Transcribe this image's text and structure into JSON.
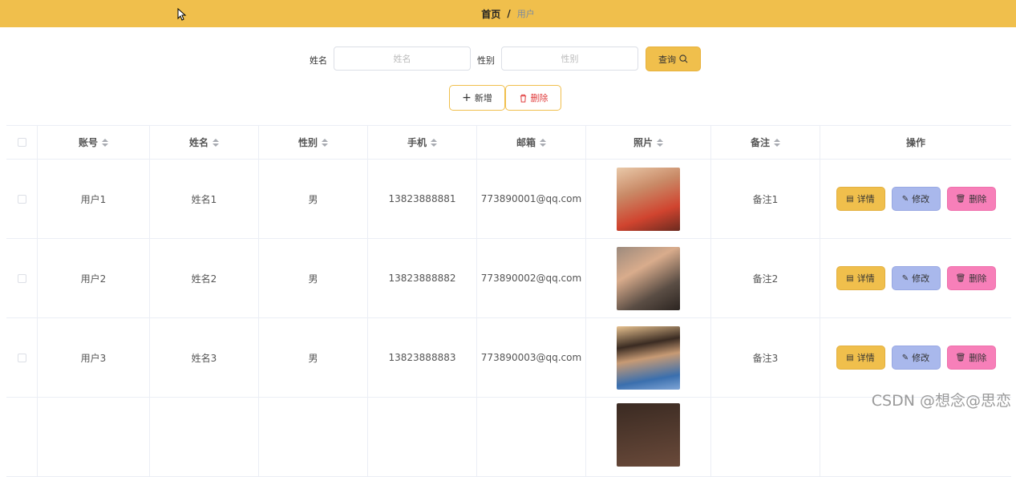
{
  "breadcrumb": {
    "home": "首页",
    "separator": "/",
    "current": "用户"
  },
  "search": {
    "name_label": "姓名",
    "name_placeholder": "姓名",
    "gender_label": "性别",
    "gender_placeholder": "性别",
    "query_label": "查询"
  },
  "actions": {
    "add_label": "新增",
    "delete_label": "删除"
  },
  "table": {
    "headers": [
      "账号",
      "姓名",
      "性别",
      "手机",
      "邮箱",
      "照片",
      "备注",
      "操作"
    ],
    "rows": [
      {
        "account": "用户1",
        "name": "姓名1",
        "gender": "男",
        "phone": "13823888881",
        "email": "773890001@qq.com",
        "remark": "备注1"
      },
      {
        "account": "用户2",
        "name": "姓名2",
        "gender": "男",
        "phone": "13823888882",
        "email": "773890002@qq.com",
        "remark": "备注2"
      },
      {
        "account": "用户3",
        "name": "姓名3",
        "gender": "男",
        "phone": "13823888883",
        "email": "773890003@qq.com",
        "remark": "备注3"
      }
    ],
    "row_actions": {
      "detail": "详情",
      "edit": "修改",
      "delete": "删除"
    }
  },
  "watermark": "CSDN @想念@思恋",
  "colors": {
    "header_bg": "#f0bf4c",
    "detail_btn": "#f0bf4c",
    "edit_btn": "#a9b8ec",
    "delete_btn": "#f77fb9",
    "delete_text": "#e03c3c"
  }
}
